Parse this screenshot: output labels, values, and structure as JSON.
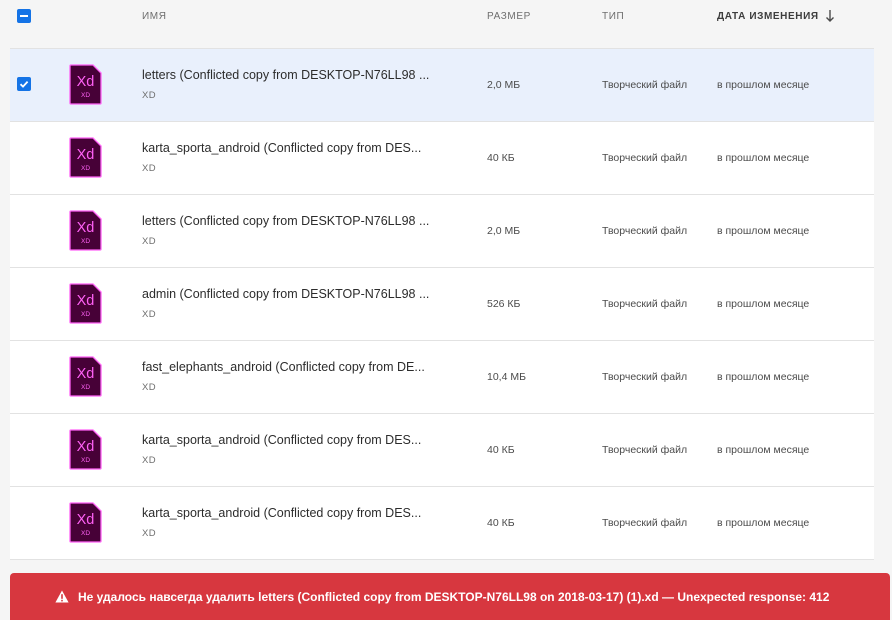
{
  "header": {
    "name": "ИМЯ",
    "size": "РАЗМЕР",
    "type": "ТИП",
    "modified": "ДАТА ИЗМЕНЕНИЯ"
  },
  "icons": {
    "file_icon_label": "Xd",
    "file_icon_sub": "XD",
    "brand_color": "#470137",
    "brand_accent": "#ff61f6"
  },
  "rows": [
    {
      "name": "letters (Conflicted copy from DESKTOP-N76LL98 ...",
      "ext": "XD",
      "size": "2,0 МБ",
      "type": "Творческий файл",
      "modified": "в прошлом месяце",
      "selected": true
    },
    {
      "name": "karta_sporta_android (Conflicted copy from DES...",
      "ext": "XD",
      "size": "40 КБ",
      "type": "Творческий файл",
      "modified": "в прошлом месяце",
      "selected": false
    },
    {
      "name": "letters (Conflicted copy from DESKTOP-N76LL98 ...",
      "ext": "XD",
      "size": "2,0 МБ",
      "type": "Творческий файл",
      "modified": "в прошлом месяце",
      "selected": false
    },
    {
      "name": "admin (Conflicted copy from DESKTOP-N76LL98 ...",
      "ext": "XD",
      "size": "526 КБ",
      "type": "Творческий файл",
      "modified": "в прошлом месяце",
      "selected": false
    },
    {
      "name": "fast_elephants_android (Conflicted copy from DE...",
      "ext": "XD",
      "size": "10,4 МБ",
      "type": "Творческий файл",
      "modified": "в прошлом месяце",
      "selected": false
    },
    {
      "name": "karta_sporta_android (Conflicted copy from DES...",
      "ext": "XD",
      "size": "40 КБ",
      "type": "Творческий файл",
      "modified": "в прошлом месяце",
      "selected": false
    },
    {
      "name": "karta_sporta_android (Conflicted copy from DES...",
      "ext": "XD",
      "size": "40 КБ",
      "type": "Творческий файл",
      "modified": "в прошлом месяце",
      "selected": false
    }
  ],
  "toast": {
    "message": "Не удалось навсегда удалить letters (Conflicted copy from DESKTOP-N76LL98 on 2018-03-17) (1).xd — Unexpected response: 412",
    "color": "#d7373f"
  }
}
